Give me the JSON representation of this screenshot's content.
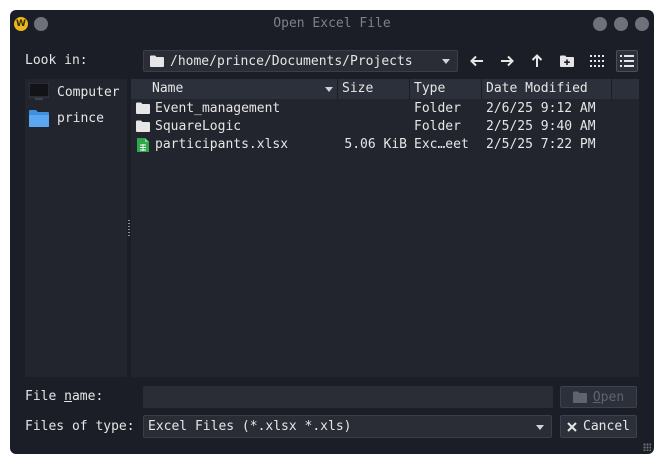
{
  "window": {
    "title": "Open Excel File",
    "app_icon_letter": "W"
  },
  "toolbar": {
    "look_in_label": "Look in:",
    "path": "/home/prince/Documents/Projects"
  },
  "sidebar": {
    "items": [
      {
        "label": "Computer",
        "icon": "monitor-icon"
      },
      {
        "label": "prince",
        "icon": "folder-icon"
      }
    ]
  },
  "file_list": {
    "columns": [
      "Name",
      "Size",
      "Type",
      "Date Modified"
    ],
    "rows": [
      {
        "name": "Event_management",
        "size": "",
        "type": "Folder",
        "date": "2/6/25 9:12 AM",
        "icon": "folder-icon"
      },
      {
        "name": "SquareLogic",
        "size": "",
        "type": "Folder",
        "date": "2/5/25 9:40 AM",
        "icon": "folder-icon"
      },
      {
        "name": "participants.xlsx",
        "size": "5.06 KiB",
        "type": "Exc…eet",
        "date": "2/5/25 7:22 PM",
        "icon": "spreadsheet-icon"
      }
    ]
  },
  "footer": {
    "file_name_label_pre": "File ",
    "file_name_label_mnemonic": "n",
    "file_name_label_post": "ame:",
    "file_name_value": "",
    "files_of_type_label": "Files of type:",
    "files_of_type_value": "Excel Files (*.xlsx *.xls)",
    "open_label_mnemonic": "O",
    "open_label_rest": "pen",
    "cancel_label": "Cancel"
  },
  "colors": {
    "window_bg": "#1b1e26",
    "panel_bg": "#22252e",
    "folder_blue": "#3d8fe0",
    "spreadsheet_green": "#2ea84a"
  }
}
